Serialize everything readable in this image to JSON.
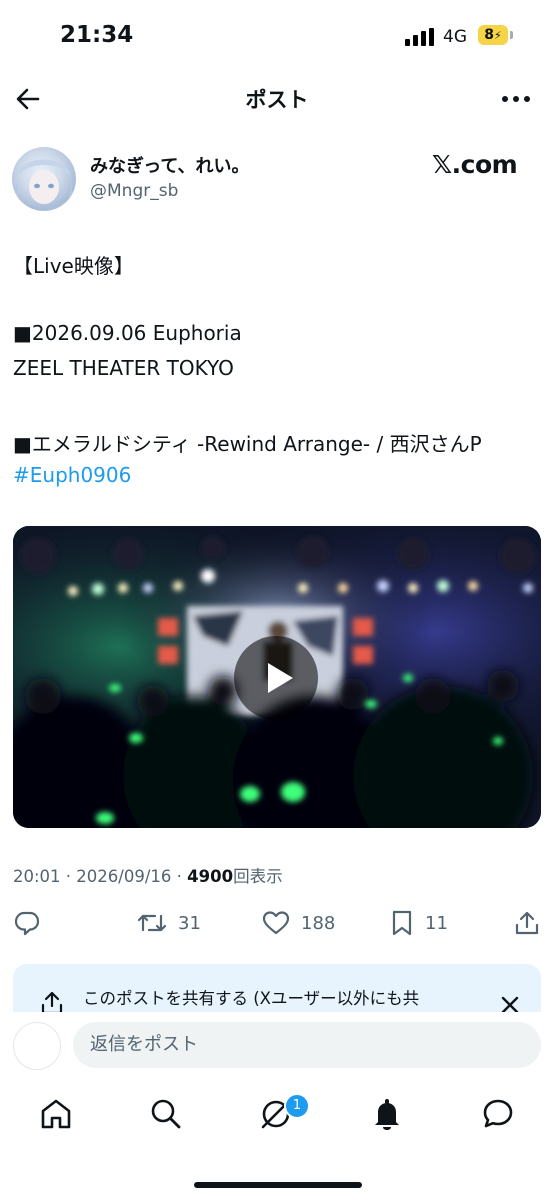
{
  "status_bar": {
    "time": "21:34",
    "network": "4G",
    "battery": "8"
  },
  "header": {
    "title": "ポスト"
  },
  "author": {
    "name": "みなぎって、れい。",
    "handle": "@Mngr_sb",
    "brand": "𝕏.com"
  },
  "post": {
    "lines": [
      "【Live映像】",
      "■2026.09.06 Euphoria",
      "ZEEL THEATER TOKYO",
      "■エメラルドシティ -Rewind Arrange- / 西沢さんP"
    ],
    "hashtag": "#Euph0906"
  },
  "meta": {
    "time_date": "20:01 · 2026/09/16 · ",
    "views": "4900",
    "views_label": "回表示"
  },
  "actions": {
    "retweets": "31",
    "likes": "188",
    "bookmarks": "11"
  },
  "share_banner": {
    "text": "このポストを共有する (Xユーザー以外にも共"
  },
  "reply": {
    "placeholder": "返信をポスト"
  },
  "nav": {
    "notification_badge": "1"
  },
  "colors": {
    "accent": "#1d9bf0",
    "secondary_text": "#536471",
    "banner_bg": "#e8f4fd"
  }
}
